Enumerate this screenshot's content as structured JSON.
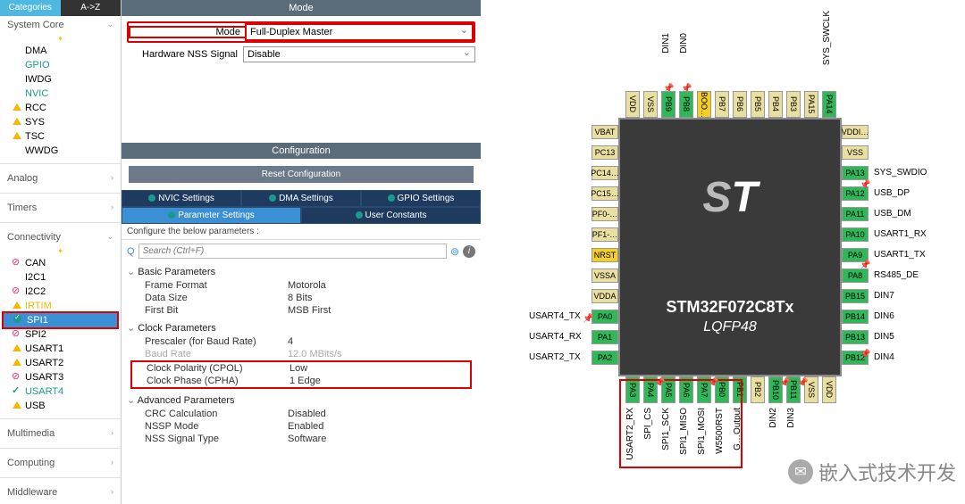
{
  "tabs": {
    "categories": "Categories",
    "az": "A->Z"
  },
  "categories": {
    "system_core": "System Core",
    "analog": "Analog",
    "timers": "Timers",
    "connectivity": "Connectivity",
    "multimedia": "Multimedia",
    "computing": "Computing",
    "middleware": "Middleware"
  },
  "system_items": [
    "DMA",
    "GPIO",
    "IWDG",
    "NVIC",
    "RCC",
    "SYS",
    "TSC",
    "WWDG"
  ],
  "conn_items": [
    "CAN",
    "I2C1",
    "I2C2",
    "IRTIM",
    "SPI1",
    "SPI2",
    "USART1",
    "USART2",
    "USART3",
    "USART4",
    "USB"
  ],
  "mode_section": "Mode",
  "mode_label": "Mode",
  "mode_value": "Full-Duplex Master",
  "hw_nss_label": "Hardware NSS Signal",
  "hw_nss_value": "Disable",
  "config_section": "Configuration",
  "reset_btn": "Reset Configuration",
  "cfg_tabs": {
    "nvic": "NVIC Settings",
    "dma": "DMA Settings",
    "gpio": "GPIO Settings",
    "param": "Parameter Settings",
    "user": "User Constants"
  },
  "hint": "Configure the below parameters :",
  "search_placeholder": "Search (Ctrl+F)",
  "groups": {
    "basic": "Basic Parameters",
    "clock": "Clock Parameters",
    "advanced": "Advanced Parameters"
  },
  "params": {
    "frame_format": {
      "k": "Frame Format",
      "v": "Motorola"
    },
    "data_size": {
      "k": "Data Size",
      "v": "8 Bits"
    },
    "first_bit": {
      "k": "First Bit",
      "v": "MSB First"
    },
    "prescaler": {
      "k": "Prescaler (for Baud Rate)",
      "v": "4"
    },
    "baud": {
      "k": "Baud Rate",
      "v": "12.0 MBits/s"
    },
    "cpol": {
      "k": "Clock Polarity (CPOL)",
      "v": "Low"
    },
    "cpha": {
      "k": "Clock Phase (CPHA)",
      "v": "1 Edge"
    },
    "crc": {
      "k": "CRC Calculation",
      "v": "Disabled"
    },
    "nssp": {
      "k": "NSSP Mode",
      "v": "Enabled"
    },
    "nss_sig": {
      "k": "NSS Signal Type",
      "v": "Software"
    }
  },
  "chip": {
    "name": "STM32F072C8Tx",
    "pkg": "LQFP48"
  },
  "pins": {
    "top": [
      "VDD",
      "VSS",
      "PB9",
      "PB8",
      "BOO…",
      "PB7",
      "PB6",
      "PB5",
      "PB4",
      "PB3",
      "PA15",
      "PA14"
    ],
    "top_labels": [
      "DIN1",
      "DIN0",
      "SYS_SWCLK"
    ],
    "left": [
      "VBAT",
      "PC13",
      "PC14…",
      "PC15…",
      "PF0-…",
      "PF1-…",
      "NRST",
      "VSSA",
      "VDDA",
      "PA0",
      "PA1",
      "PA2"
    ],
    "left_labels": [
      "USART4_TX",
      "USART4_RX",
      "USART2_TX"
    ],
    "right": [
      "VDDI…",
      "VSS",
      "PA13",
      "PA12",
      "PA11",
      "PA10",
      "PA9",
      "PA8",
      "PB15",
      "PB14",
      "PB13",
      "PB12"
    ],
    "right_labels": [
      "SYS_SWDIO",
      "USB_DP",
      "USB_DM",
      "USART1_RX",
      "USART1_TX",
      "RS485_DE",
      "DIN7",
      "DIN6",
      "DIN5",
      "DIN4"
    ],
    "bottom": [
      "PA3",
      "PA4",
      "PA5",
      "PA6",
      "PA7",
      "PB0",
      "PB1",
      "PB2",
      "PB10",
      "PB11",
      "VSS",
      "VDD"
    ],
    "bottom_labels": [
      "USART2_RX",
      "SPI_CS",
      "SPI1_SCK",
      "SPI1_MISO",
      "SPI1_MOSI",
      "W5500RST",
      "G…Output",
      "",
      "DIN2",
      "DIN3"
    ]
  },
  "watermark": "嵌入式技术开发"
}
